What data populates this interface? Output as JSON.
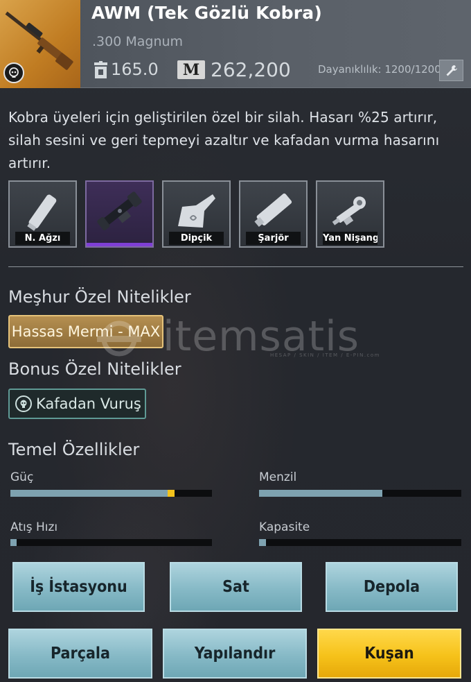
{
  "header": {
    "title": "AWM (Tek Gözlü Kobra)",
    "ammo": ".300 Magnum",
    "weight": "165.0",
    "currency_icon": "M",
    "price": "262,200",
    "durability": "Dayanıklılık: 1200/1200",
    "icons": {
      "weight": "weight-icon",
      "currency": "m-currency-icon",
      "repair": "wrench-icon",
      "badge": "skull-badge-icon"
    }
  },
  "description": "Kobra üyeleri için geliştirilen özel bir silah. Hasarı %25 artırır, silah sesini ve geri tepmeyi azaltır ve kafadan vurma hasarını artırır.",
  "attachments": [
    {
      "label": "N. Ağzı",
      "icon": "muzzle-icon",
      "active": false
    },
    {
      "label": "",
      "icon": "scope-icon",
      "active": true
    },
    {
      "label": "Dipçik",
      "icon": "stock-icon",
      "active": false
    },
    {
      "label": "Şarjör",
      "icon": "magazine-icon",
      "active": false
    },
    {
      "label": "Yan Nişangâh",
      "icon": "side-sight-icon",
      "active": false
    }
  ],
  "traits": {
    "famous_title": "Meşhur Özel Nitelikler",
    "famous_value": "Hassas Mermi - MAX",
    "bonus_title": "Bonus Özel Nitelikler",
    "bonus_value": "Kafadan Vuruş"
  },
  "stats": {
    "title": "Temel Özellikler",
    "items": [
      {
        "label": "Güç",
        "value": 0.78,
        "bonus": 0.035
      },
      {
        "label": "Menzil",
        "value": 0.61,
        "bonus": 0
      },
      {
        "label": "Atış Hızı",
        "value": 0.03,
        "bonus": 0
      },
      {
        "label": "Kapasite",
        "value": 0.035,
        "bonus": 0
      }
    ]
  },
  "buttons": {
    "workstation": "İş İstasyonu",
    "sell": "Sat",
    "store": "Depola",
    "dismantle": "Parçala",
    "configure": "Yapılandır",
    "equip": "Kuşan"
  },
  "watermark": {
    "brand": "itemsatis",
    "tagline": "HESAP / SKIN / ITEM / E-PIN",
    "suffix": ".com"
  },
  "colors": {
    "accent_gold": "#f6c21a",
    "button_teal": "#86b9c6",
    "bar_fill": "#7ea2b0",
    "bonus_yellow": "#f2c21c",
    "scope_purple": "#7f3fd6"
  }
}
